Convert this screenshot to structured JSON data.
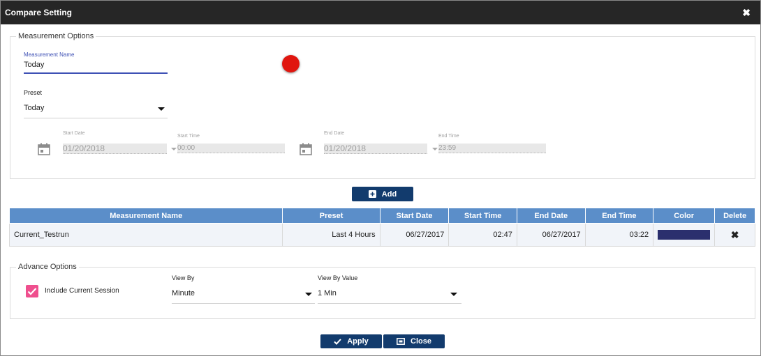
{
  "dialog": {
    "title": "Compare Setting",
    "close_glyph": "✖"
  },
  "measurement_options": {
    "legend": "Measurement Options",
    "measurement_name": {
      "label": "Measurement Name",
      "value": "Today"
    },
    "color_swatch": "#e0160f",
    "preset": {
      "label": "Preset",
      "value": "Today"
    },
    "start_date": {
      "label": "Start Date",
      "value": "01/20/2018"
    },
    "start_time": {
      "label": "Start Time",
      "value": "00:00"
    },
    "end_date": {
      "label": "End Date",
      "value": "01/20/2018"
    },
    "end_time": {
      "label": "End Time",
      "value": "23:59"
    }
  },
  "add_button": {
    "label": "Add"
  },
  "table": {
    "columns": [
      "Measurement Name",
      "Preset",
      "Start Date",
      "Start Time",
      "End Date",
      "End Time",
      "Color",
      "Delete"
    ],
    "rows": [
      {
        "name": "Current_Testrun",
        "preset": "Last 4 Hours",
        "start_date": "06/27/2017",
        "start_time": "02:47",
        "end_date": "06/27/2017",
        "end_time": "03:22",
        "color": "#2b2f6e",
        "delete_glyph": "✖"
      }
    ]
  },
  "advance_options": {
    "legend": "Advance Options",
    "include_current_session": {
      "label": "Include Current Session",
      "checked": true
    },
    "view_by": {
      "label": "View By",
      "value": "Minute"
    },
    "view_by_value": {
      "label": "View By Value",
      "value": "1 Min"
    }
  },
  "footer": {
    "apply_label": "Apply",
    "close_label": "Close"
  },
  "colors": {
    "titlebar": "#262626",
    "header": "#5b8ec9",
    "button": "#123b6d",
    "accent": "#3f51b5",
    "checkbox": "#ef4f8e"
  }
}
